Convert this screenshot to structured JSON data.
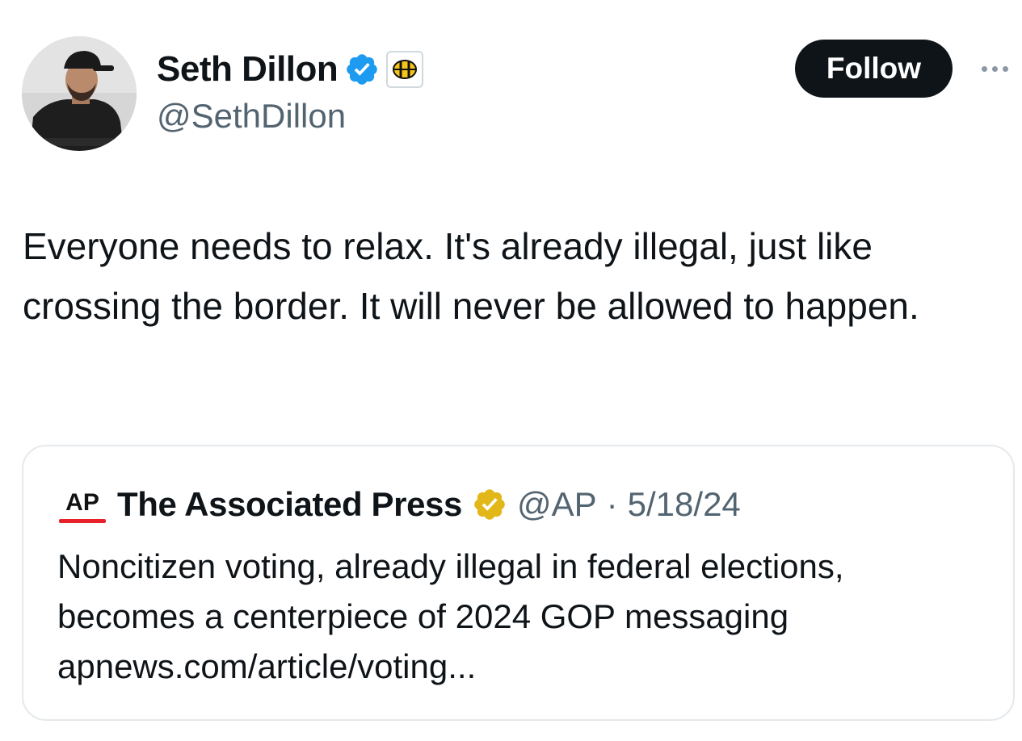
{
  "author": {
    "display_name": "Seth Dillon",
    "handle": "@SethDillon",
    "verified_badge": "blue-check-icon",
    "affiliation_badge": "babylon-bee-icon"
  },
  "actions": {
    "follow_label": "Follow",
    "more_icon": "more-dots-icon"
  },
  "tweet": {
    "text": "Everyone needs to relax. It's already illegal, just like crossing the border. It will never be allowed to happen."
  },
  "quoted_tweet": {
    "display_name": "The Associated Press",
    "handle": "@AP",
    "separator": "·",
    "date": "5/18/24",
    "badge": "gold-check-icon",
    "logo": "ap-logo",
    "text_line1": "Noncitizen voting, already illegal in federal elections,",
    "text_line2": "becomes a centerpiece of 2024 GOP messaging",
    "link": "apnews.com/article/voting..."
  },
  "colors": {
    "accent_blue": "#1d9bf0",
    "gold": "#e2b719",
    "ap_red": "#e8202a",
    "text_primary": "#0f1419",
    "text_secondary": "#536471"
  }
}
